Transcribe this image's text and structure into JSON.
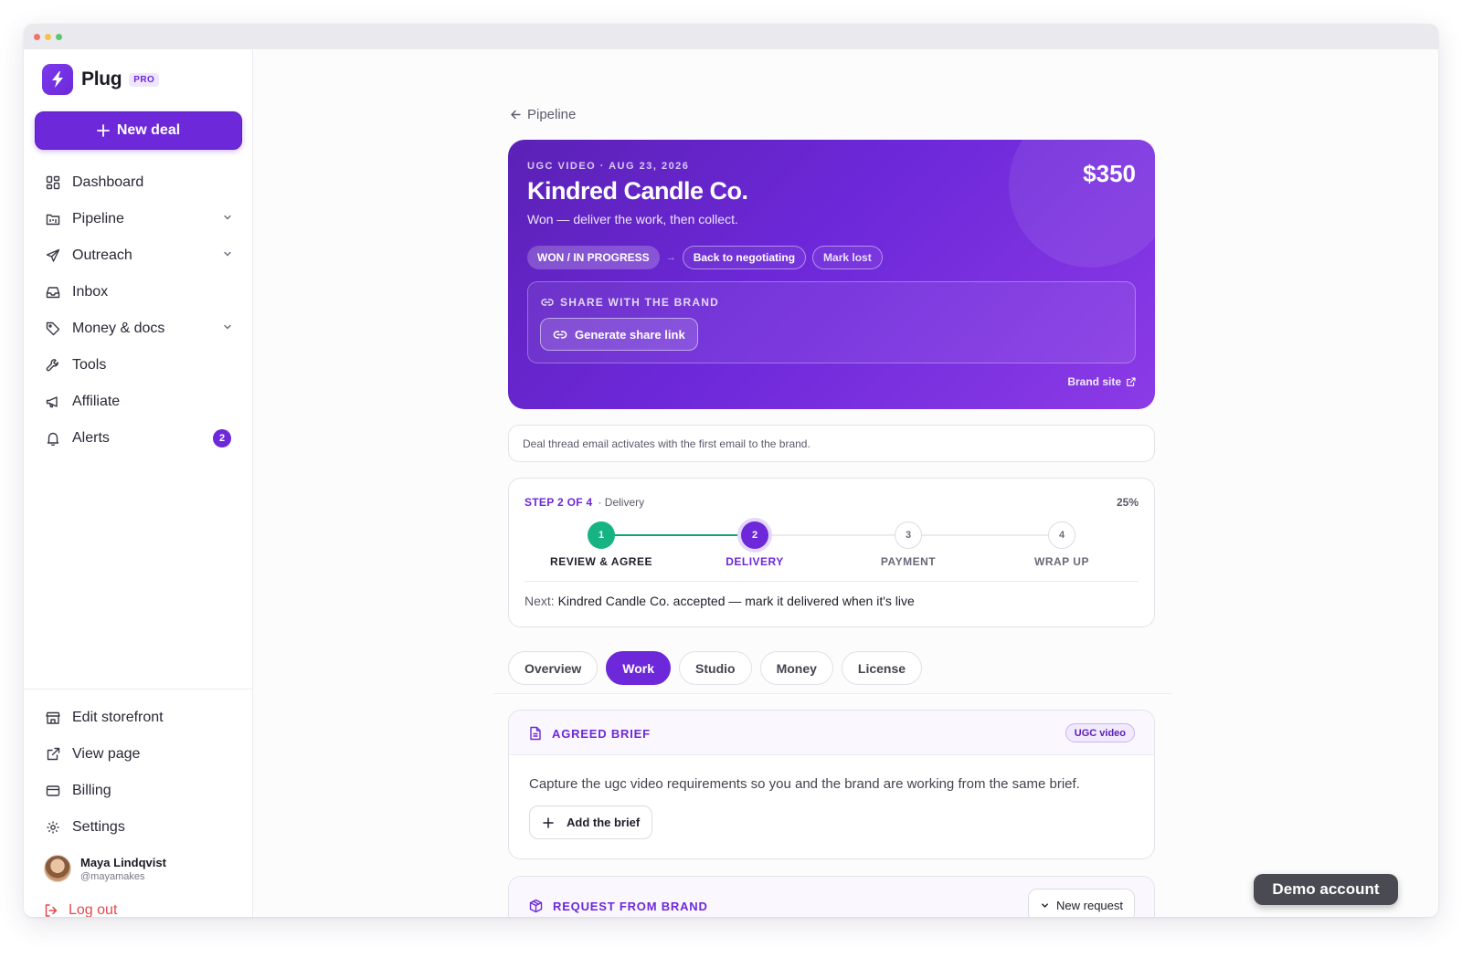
{
  "app": {
    "name": "Plug",
    "plan_badge": "PRO"
  },
  "sidebar": {
    "new_deal_label": "New deal",
    "items": [
      {
        "label": "Dashboard",
        "icon": "grid-icon"
      },
      {
        "label": "Pipeline",
        "icon": "board-icon",
        "expandable": true
      },
      {
        "label": "Outreach",
        "icon": "send-icon",
        "expandable": true
      },
      {
        "label": "Inbox",
        "icon": "inbox-icon"
      },
      {
        "label": "Money & docs",
        "icon": "tag-icon",
        "expandable": true
      },
      {
        "label": "Tools",
        "icon": "wrench-icon"
      },
      {
        "label": "Affiliate",
        "icon": "megaphone-icon"
      },
      {
        "label": "Alerts",
        "icon": "bell-icon",
        "badge": "2"
      }
    ],
    "bottom_items": [
      {
        "label": "Edit storefront",
        "icon": "store-icon"
      },
      {
        "label": "View page",
        "icon": "external-link-icon"
      },
      {
        "label": "Billing",
        "icon": "card-icon"
      },
      {
        "label": "Settings",
        "icon": "gear-icon"
      }
    ],
    "user": {
      "name": "Maya Lindqvist",
      "handle": "@mayamakes"
    },
    "logout_label": "Log out"
  },
  "back_link": "Pipeline",
  "deal": {
    "meta": "UGC VIDEO · AUG 23, 2026",
    "title": "Kindred Candle Co.",
    "subtitle": "Won — deliver the work, then collect.",
    "amount": "$350",
    "status": "WON / IN PROGRESS",
    "arrow": "→",
    "action_back": "Back to negotiating",
    "action_lost": "Mark lost",
    "share_label": "SHARE WITH THE BRAND",
    "share_button": "Generate share link",
    "brand_site": "Brand site"
  },
  "notice": "Deal thread email activates with the first email to the brand.",
  "progress": {
    "step_label": "STEP 2 OF 4",
    "phase": "· Delivery",
    "percent": "25%",
    "steps": [
      {
        "num": "1",
        "label": "REVIEW & AGREE",
        "state": "done"
      },
      {
        "num": "2",
        "label": "DELIVERY",
        "state": "active"
      },
      {
        "num": "3",
        "label": "PAYMENT",
        "state": "todo"
      },
      {
        "num": "4",
        "label": "WRAP UP",
        "state": "todo"
      }
    ],
    "next_label": "Next:",
    "next_text": "Kindred Candle Co. accepted — mark it delivered when it's live"
  },
  "tabs": [
    {
      "label": "Overview",
      "active": false
    },
    {
      "label": "Work",
      "active": true
    },
    {
      "label": "Studio",
      "active": false
    },
    {
      "label": "Money",
      "active": false
    },
    {
      "label": "License",
      "active": false
    }
  ],
  "brief": {
    "title": "AGREED BRIEF",
    "type_badge": "UGC video",
    "description": "Capture the ugc video requirements so you and the brand are working from the same brief.",
    "add_label": "Add the brief"
  },
  "request": {
    "title": "REQUEST FROM BRAND",
    "button_label": "New request"
  },
  "demo_badge": "Demo account",
  "colors": {
    "accent": "#6d28d9",
    "success": "#16b383",
    "danger": "#e5484d"
  }
}
